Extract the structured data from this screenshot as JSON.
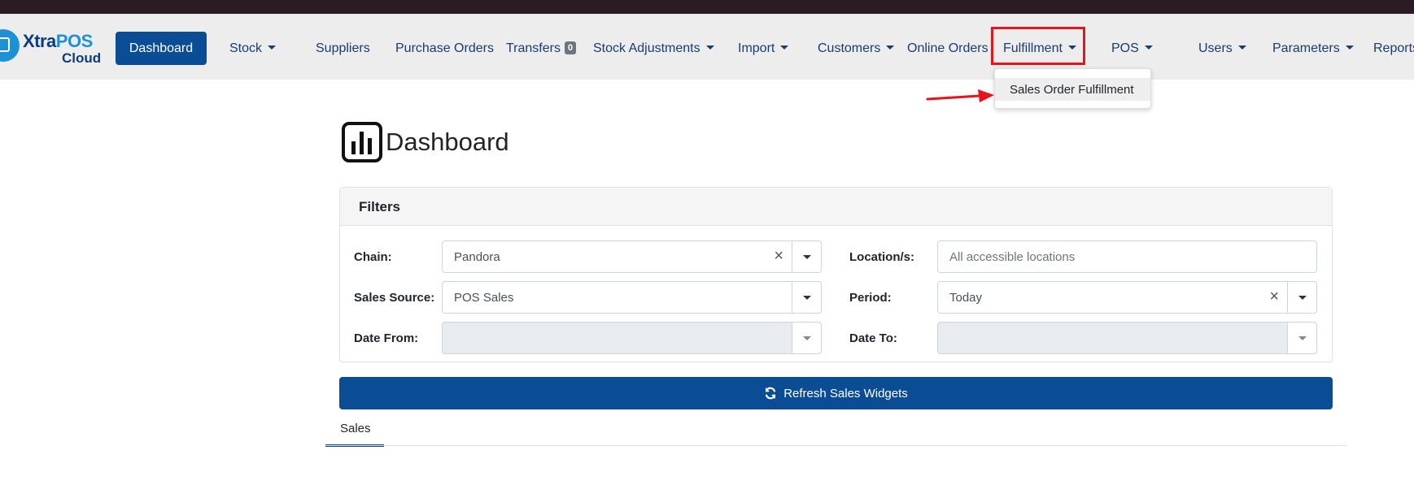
{
  "brand": {
    "name_part1": "Xtra",
    "name_part2": "POS",
    "sub": "Cloud"
  },
  "nav": {
    "dashboard": "Dashboard",
    "stock": "Stock",
    "suppliers": "Suppliers",
    "purchase_orders": "Purchase Orders",
    "transfers": "Transfers",
    "transfers_badge": "0",
    "stock_adjustments": "Stock Adjustments",
    "import": "Import",
    "customers": "Customers",
    "online_orders": "Online Orders",
    "fulfillment": "Fulfillment",
    "pos": "POS",
    "users": "Users",
    "parameters": "Parameters",
    "reports": "Reports"
  },
  "fulfillment_menu": {
    "items": [
      "Sales Order Fulfillment"
    ]
  },
  "page": {
    "title": "Dashboard",
    "icon": "bar-chart-icon"
  },
  "filters": {
    "header": "Filters",
    "chain": {
      "label": "Chain:",
      "value": "Pandora"
    },
    "location": {
      "label": "Location/s:",
      "placeholder": "All accessible locations"
    },
    "sales_source": {
      "label": "Sales Source:",
      "value": "POS Sales"
    },
    "period": {
      "label": "Period:",
      "value": "Today"
    },
    "date_from": {
      "label": "Date From:",
      "value": ""
    },
    "date_to": {
      "label": "Date To:",
      "value": ""
    }
  },
  "refresh_button": "Refresh Sales Widgets",
  "tabs": {
    "sales": "Sales"
  },
  "colors": {
    "primary": "#0b4d94",
    "highlight": "#e8141b",
    "topbar": "#2b1b25",
    "navbar": "#ededed"
  }
}
